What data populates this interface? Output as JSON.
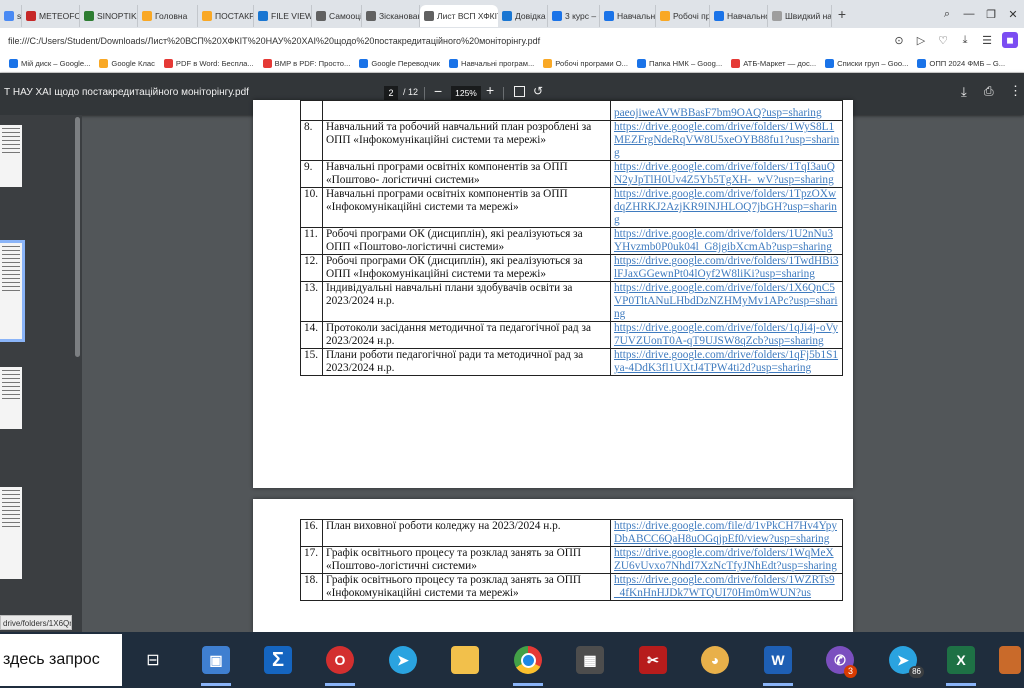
{
  "browser": {
    "tabs": [
      {
        "title": "sher",
        "color": "#4a8af4"
      },
      {
        "title": "METEOFOR",
        "color": "#c62828"
      },
      {
        "title": "SINOPTIK: П",
        "color": "#2e7d32"
      },
      {
        "title": "Головна",
        "color": "#f9a825"
      },
      {
        "title": "ПОСТАКРЕД",
        "color": "#f9a825"
      },
      {
        "title": "FILE VIEW",
        "color": "#1976d2"
      },
      {
        "title": "Самооцінк",
        "color": "#616161"
      },
      {
        "title": "Зіскановані",
        "color": "#616161"
      },
      {
        "title": "Лист ВСП ХФКІТ НАУ",
        "color": "#616161",
        "active": true
      },
      {
        "title": "Довідка ОП",
        "color": "#1976d2"
      },
      {
        "title": "3 курс – Goo",
        "color": "#1a73e8"
      },
      {
        "title": "Навчальні п",
        "color": "#1a73e8"
      },
      {
        "title": "Робочі прог",
        "color": "#f9a825"
      },
      {
        "title": "Навчально-",
        "color": "#1a73e8"
      },
      {
        "title": "Швидкий на",
        "color": "#9e9e9e"
      }
    ],
    "url": "file:///C:/Users/Student/Downloads/Лист%20ВСП%20ХФКІТ%20НАУ%20ХАІ%20щодо%20постакредитаційного%20моніторінгу.pdf",
    "bookmarks": [
      {
        "label": "Мій диск – Google...",
        "color": "#1a73e8"
      },
      {
        "label": "Google Клас",
        "color": "#f9a825"
      },
      {
        "label": "PDF в Word: Беспла...",
        "color": "#e53935"
      },
      {
        "label": "BMP в PDF: Просто...",
        "color": "#e53935"
      },
      {
        "label": "Google Переводчик",
        "color": "#1a73e8"
      },
      {
        "label": "Навчальні програм...",
        "color": "#1a73e8"
      },
      {
        "label": "Робочі програми О...",
        "color": "#f9a825"
      },
      {
        "label": "Папка НМК – Goog...",
        "color": "#1a73e8"
      },
      {
        "label": "АТБ-Маркет — дос...",
        "color": "#e53935"
      },
      {
        "label": "Списки груп – Goo...",
        "color": "#1a73e8"
      },
      {
        "label": "ОПП 2024 ФМБ – G...",
        "color": "#1a73e8"
      }
    ]
  },
  "pdf": {
    "title": "Т НАУ ХАІ щодо постакредитаційного моніторінгу.pdf",
    "current_page": "2",
    "total_pages": "/ 12",
    "zoom": "125%",
    "sidebar_link": "drive/folders/1X6Qn",
    "page1_rows": [
      {
        "num": "",
        "text": "",
        "link": "paeojiweAVWBBasF7bm9OAQ?usp=sharing"
      },
      {
        "num": "8.",
        "text": "Навчальний та робочий навчальний план розроблені за ОПП «Інфокомунікаційні системи та мережі»",
        "link": "https://drive.google.com/drive/folders/1WyS8L1MEZFrgNdeRqVW8U5xeOYB88fu1?usp=sharing"
      },
      {
        "num": "9.",
        "text": "Навчальні програми освітніх компонентів за ОПП «Поштово- логістичні системи»",
        "link": "https://drive.google.com/drive/folders/1TqI3auQN2yJpTlH0Uv4Z5Yb5TgXH-_wV?usp=sharing"
      },
      {
        "num": "10.",
        "text": "Навчальні програми освітніх компонентів за ОПП «Інфокомунікаційні системи та мережі»",
        "link": "https://drive.google.com/drive/folders/1TpzOXwdqZHRKJ2AzjKR9INJHLOQ7jbGH?usp=sharing"
      },
      {
        "num": "11.",
        "text": "Робочі програми ОК (дисциплін), які реалізуються за ОПП «Поштово-логістичні системи»",
        "link": "https://drive.google.com/drive/folders/1U2nNu3YHvzmb0P0uk04l_G8jgibXcmAb?usp=sharing"
      },
      {
        "num": "12.",
        "text": "Робочі програми ОК (дисциплін), які реалізуються за ОПП «Інфокомунікаційні системи та мережі»",
        "link": "https://drive.google.com/drive/folders/1TwdHBi3lFJaxGGewnPt04lOyf2W8liKi?usp=sharing"
      },
      {
        "num": "13.",
        "text": "Індивідуальні навчальні плани здобувачів освіти за 2023/2024 н.р.",
        "link": "https://drive.google.com/drive/folders/1X6QnC5VP0TltANuLHbdDzNZHMyMv1APc?usp=sharing"
      },
      {
        "num": "14.",
        "text": "Протоколи засідання методичної та педагогічної рад за 2023/2024 н.р.",
        "link": "https://drive.google.com/drive/folders/1qJi4j-oVy7UVZUonT0A-qT9UJSW8qZcb?usp=sharing"
      },
      {
        "num": "15.",
        "text": "Плани роботи педагогічної ради та методичної рад за 2023/2024 н.р.",
        "link": "https://drive.google.com/drive/folders/1qFj5b1S1ya-4DdK3fl1UXtJ4TPW4ti2d?usp=sharing"
      }
    ],
    "page2_rows": [
      {
        "num": "16.",
        "text": "План виховної роботи коледжу на 2023/2024 н.р.",
        "link": "https://drive.google.com/file/d/1vPkCH7Hv4YpyDbABCC6QaH8uOGqjpEf0/view?usp=sharing"
      },
      {
        "num": "17.",
        "text": "Графік освітнього процесу та розклад занять за ОПП «Поштово-логістичні системи»",
        "link": "https://drive.google.com/drive/folders/1WqMeXZU6vUvxo7NhdI7XzNcTfyJNhEdt?usp=sharing"
      },
      {
        "num": "18.",
        "text": "Графік освітнього процесу та розклад занять за ОПП «Інфокомунікаційні системи та мережі»",
        "link": "https://drive.google.com/drive/folders/1WZRTs9_4fKnHnHJDk7WTQUI70Hm0mWUN?us"
      }
    ]
  },
  "taskbar": {
    "search_text": "здесь запрос",
    "viber_badge": "3",
    "telegram_badge": "86"
  }
}
